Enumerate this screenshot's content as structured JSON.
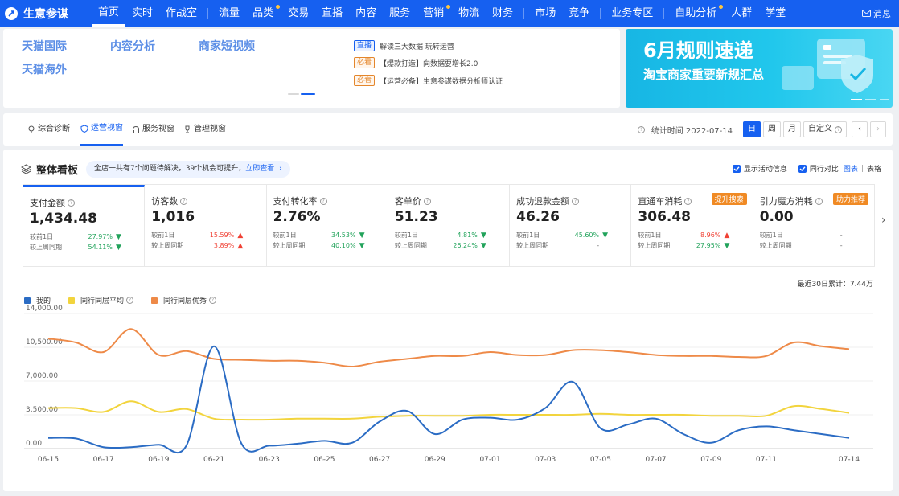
{
  "nav": {
    "brand": "生意参谋",
    "items": [
      {
        "label": "首页",
        "active": true,
        "dot": false
      },
      {
        "label": "实时",
        "active": false,
        "dot": false
      },
      {
        "label": "作战室",
        "active": false,
        "dot": false
      },
      {
        "sep": true
      },
      {
        "label": "流量",
        "active": false,
        "dot": false
      },
      {
        "label": "品类",
        "active": false,
        "dot": true
      },
      {
        "label": "交易",
        "active": false,
        "dot": false
      },
      {
        "label": "直播",
        "active": false,
        "dot": false
      },
      {
        "label": "内容",
        "active": false,
        "dot": false
      },
      {
        "label": "服务",
        "active": false,
        "dot": false
      },
      {
        "label": "营销",
        "active": false,
        "dot": true
      },
      {
        "label": "物流",
        "active": false,
        "dot": false
      },
      {
        "label": "财务",
        "active": false,
        "dot": false
      },
      {
        "sep": true
      },
      {
        "label": "市场",
        "active": false,
        "dot": false
      },
      {
        "label": "竞争",
        "active": false,
        "dot": false
      },
      {
        "sep": true
      },
      {
        "label": "业务专区",
        "active": false,
        "dot": false
      },
      {
        "sep": true
      },
      {
        "label": "自助分析",
        "active": false,
        "dot": true
      },
      {
        "label": "人群",
        "active": false,
        "dot": false
      },
      {
        "label": "学堂",
        "active": false,
        "dot": false
      }
    ],
    "message": "消息"
  },
  "quicklinks": {
    "tmall_intl": "天猫国际",
    "content_analysis": "内容分析",
    "merchant_video": "商家短视频",
    "tmall_overseas": "天猫海外"
  },
  "notices": [
    {
      "tag": "直播",
      "tag_color": "blue",
      "text": "解读三大数据 玩转运营"
    },
    {
      "tag": "必看",
      "tag_color": "orange",
      "text": "【爆款打造】向数据要增长2.0"
    },
    {
      "tag": "必看",
      "tag_color": "orange",
      "text": "【运营必备】生意参谋数据分析师认证"
    }
  ],
  "promo": {
    "title": "6月规则速递",
    "subtitle": "淘宝商家重要新规汇总"
  },
  "tabs": [
    {
      "label": "综合诊断",
      "icon": "diagnosis-icon",
      "active": false
    },
    {
      "label": "运营视窗",
      "icon": "shield-icon",
      "active": true
    },
    {
      "label": "服务视窗",
      "icon": "headset-icon",
      "active": false
    },
    {
      "label": "管理视窗",
      "icon": "trophy-icon",
      "active": false
    }
  ],
  "date_ctrl": {
    "stat_time": "统计时间 2022-07-14",
    "day": "日",
    "week": "周",
    "month": "月",
    "custom": "自定义"
  },
  "board": {
    "title": "整体看板",
    "issue_text": "全店一共有7个问题待解决，39个机会可提升，",
    "issue_link": "立即查看",
    "show_activity": "显示活动信息",
    "peer_compare": "同行对比",
    "view_chart": "图表",
    "view_divider": "|",
    "view_table": "表格"
  },
  "metrics": [
    {
      "label": "支付金额",
      "value": "1,434.48",
      "r1": "较前1日",
      "v1": "27.97%",
      "d1": "down",
      "r2": "较上周同期",
      "v2": "54.11%",
      "d2": "down",
      "selected": true,
      "badge": ""
    },
    {
      "label": "访客数",
      "value": "1,016",
      "r1": "较前1日",
      "v1": "15.59%",
      "d1": "up",
      "r2": "较上周同期",
      "v2": "3.89%",
      "d2": "up",
      "selected": false,
      "badge": ""
    },
    {
      "label": "支付转化率",
      "value": "2.76%",
      "r1": "较前1日",
      "v1": "34.53%",
      "d1": "down",
      "r2": "较上周同期",
      "v2": "40.10%",
      "d2": "down",
      "selected": false,
      "badge": ""
    },
    {
      "label": "客单价",
      "value": "51.23",
      "r1": "较前1日",
      "v1": "4.81%",
      "d1": "down",
      "r2": "较上周同期",
      "v2": "26.24%",
      "d2": "down",
      "selected": false,
      "badge": ""
    },
    {
      "label": "成功退款金额",
      "value": "46.26",
      "r1": "较前1日",
      "v1": "45.60%",
      "d1": "down",
      "r2": "较上周同期",
      "v2": "-",
      "d2": "none",
      "selected": false,
      "badge": ""
    },
    {
      "label": "直通车消耗",
      "value": "306.48",
      "r1": "较前1日",
      "v1": "8.96%",
      "d1": "up",
      "r2": "较上周同期",
      "v2": "27.95%",
      "d2": "down",
      "selected": false,
      "badge": "提升搜索"
    },
    {
      "label": "引力魔方消耗",
      "value": "0.00",
      "r1": "较前1日",
      "v1": "-",
      "d1": "none",
      "r2": "较上周同期",
      "v2": "-",
      "d2": "none",
      "selected": false,
      "badge": "助力推荐"
    }
  ],
  "cumulative": "最近30日累计：7.44万",
  "colors": {
    "mine": "#2b6cc4",
    "peer_avg": "#f2d43d",
    "peer_best": "#ee8a48",
    "up": "#f04134",
    "down": "#22a35b",
    "accent": "#1660f0"
  },
  "chart_data": {
    "type": "line",
    "x": [
      "06-15",
      "06-16",
      "06-17",
      "06-18",
      "06-19",
      "06-20",
      "06-21",
      "06-22",
      "06-23",
      "06-24",
      "06-25",
      "06-26",
      "06-27",
      "06-28",
      "06-29",
      "06-30",
      "07-01",
      "07-02",
      "07-03",
      "07-04",
      "07-05",
      "07-06",
      "07-07",
      "07-08",
      "07-09",
      "07-10",
      "07-11",
      "07-12",
      "07-13",
      "07-14"
    ],
    "x_tick_labels": [
      "06-15",
      "06-17",
      "06-19",
      "06-21",
      "06-23",
      "06-25",
      "06-27",
      "06-29",
      "07-01",
      "07-03",
      "07-05",
      "07-07",
      "07-09",
      "07-11",
      "07-14"
    ],
    "y_ticks": [
      "0.00",
      "3,500.00",
      "7,000.00",
      "10,500.00",
      "14,000.00"
    ],
    "ylim": [
      0,
      14000
    ],
    "grid": "horizontal",
    "legend_position": "top-left",
    "series": [
      {
        "name": "我的",
        "values": [
          1100,
          1050,
          150,
          150,
          400,
          300,
          10600,
          500,
          300,
          500,
          800,
          600,
          2800,
          3900,
          1500,
          3000,
          3200,
          3000,
          4200,
          6900,
          2100,
          2500,
          3100,
          1500,
          600,
          1900,
          2300,
          1900,
          1500,
          1100
        ]
      },
      {
        "name": "同行同层平均",
        "values": [
          4200,
          4200,
          3800,
          4900,
          3800,
          4100,
          3100,
          3000,
          3000,
          3100,
          3100,
          3100,
          3300,
          3400,
          3400,
          3400,
          3500,
          3500,
          3500,
          3500,
          3600,
          3500,
          3500,
          3500,
          3400,
          3400,
          3400,
          4400,
          4100,
          3700
        ]
      },
      {
        "name": "同行同层优秀",
        "values": [
          11400,
          11000,
          10000,
          12400,
          9700,
          10100,
          9300,
          9200,
          9100,
          9100,
          8900,
          8500,
          9000,
          9300,
          9600,
          9600,
          10000,
          9700,
          9700,
          10200,
          10200,
          10000,
          9700,
          9600,
          9600,
          9500,
          9600,
          11000,
          10600,
          10300
        ]
      }
    ]
  }
}
